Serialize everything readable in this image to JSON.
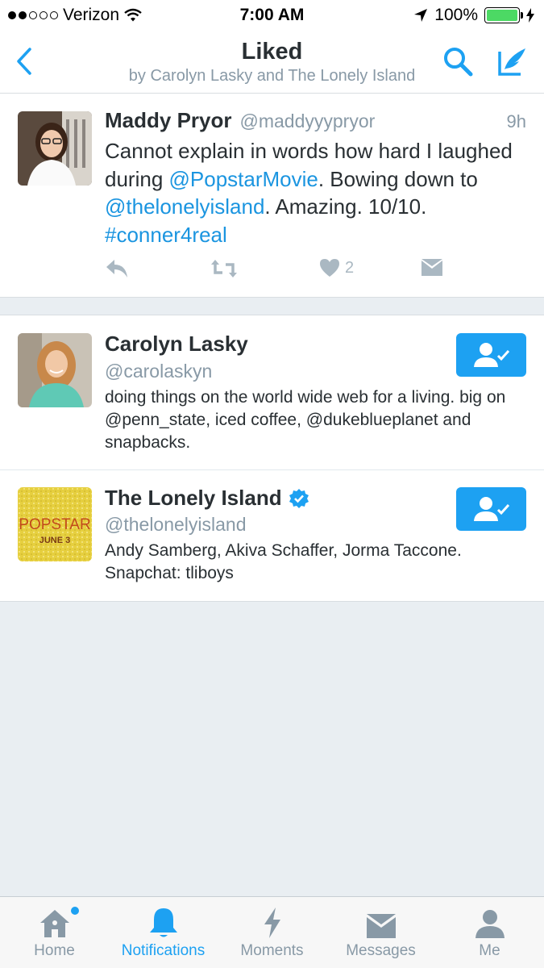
{
  "status_bar": {
    "carrier": "Verizon",
    "time": "7:00 AM",
    "battery": "100%",
    "signal_bars_filled": 2,
    "signal_bars_total": 5
  },
  "header": {
    "title": "Liked",
    "subtitle": "by Carolyn Lasky and The Lonely Island",
    "back_icon": "chevron-left-icon",
    "search_icon": "search-icon",
    "compose_icon": "compose-tweet-icon"
  },
  "tweet": {
    "name": "Maddy Pryor",
    "handle": "@maddyyypryor",
    "time": "9h",
    "text_1": "Cannot explain in words how hard I laughed during ",
    "mention_1": "@PopstarMovie",
    "text_2": ". Bowing down to ",
    "mention_2": "@thelonelyisland",
    "text_3": ". Amazing. 10/10. ",
    "hashtag": "#conner4real",
    "like_count": "2"
  },
  "people": [
    {
      "name": "Carolyn Lasky",
      "handle": "@carolaskyn",
      "bio": "doing things on the world wide web for a living. big on @penn_state, iced coffee, @dukeblueplanet and snapbacks.",
      "verified": false
    },
    {
      "name": "The Lonely Island",
      "handle": "@thelonelyisland",
      "bio": "Andy Samberg, Akiva Schaffer, Jorma Taccone. Snapchat: tliboys",
      "verified": true,
      "avatar_text_1": "POPSTAR",
      "avatar_text_2": "JUNE 3"
    }
  ],
  "tabs": [
    {
      "label": "Home",
      "icon": "home-icon",
      "active": false
    },
    {
      "label": "Notifications",
      "icon": "bell-icon",
      "active": true
    },
    {
      "label": "Moments",
      "icon": "lightning-icon",
      "active": false
    },
    {
      "label": "Messages",
      "icon": "envelope-icon",
      "active": false
    },
    {
      "label": "Me",
      "icon": "person-icon",
      "active": false
    }
  ],
  "colors": {
    "accent": "#1da1f2",
    "link": "#1b95e0",
    "secondary_text": "#8899a6",
    "background": "#e9eef2"
  }
}
